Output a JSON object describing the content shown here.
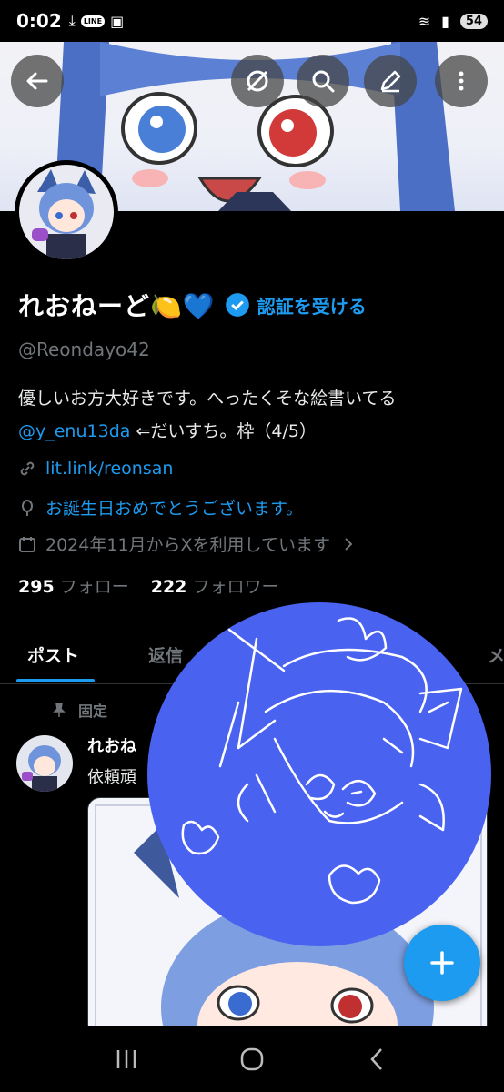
{
  "status_bar": {
    "time": "0:02",
    "line_badge": "LINE",
    "battery": "54"
  },
  "header": {
    "icons": [
      "back-arrow-icon",
      "grok-icon",
      "search-icon",
      "edit-icon",
      "more-icon"
    ]
  },
  "profile": {
    "display_name": "れおねーど🍋💙",
    "verify_cta": "認証を受ける",
    "handle": "@Reondayo42",
    "bio_line1": "優しいお方大好きです。へったくそな絵書いてる",
    "bio_mention": "@y_enu13da",
    "bio_line2_rest": " ⇐だいすち。枠（4/5）",
    "link": "lit.link/reonsan",
    "birthday": "お誕生日おめでとうございます。",
    "joined": "2024年11月からXを利用しています",
    "following_count": "295",
    "following_label": "フォロー",
    "followers_count": "222",
    "followers_label": "フォロワー"
  },
  "tabs": {
    "posts": "ポスト",
    "replies": "返信",
    "media": "メ"
  },
  "pinned_post": {
    "pinned_label": "固定",
    "author": "れおね",
    "text": "依頼頑"
  },
  "colors": {
    "accent": "#1d9bf0",
    "doodle": "#4a62f0"
  }
}
